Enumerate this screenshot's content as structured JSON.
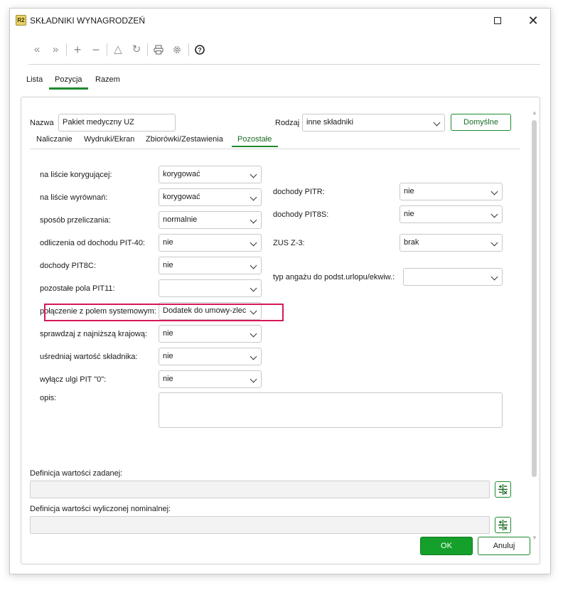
{
  "window": {
    "title": "SKŁADNIKI WYNAGRODZEŃ",
    "app_icon_text": "R2"
  },
  "toolbar": {
    "icons": [
      "first-icon",
      "last-icon",
      "add-icon",
      "remove-icon",
      "warning-icon",
      "refresh-icon",
      "print-icon",
      "settings-icon",
      "help-icon"
    ]
  },
  "main_tabs": [
    {
      "label": "Lista",
      "active": false
    },
    {
      "label": "Pozycja",
      "active": true
    },
    {
      "label": "Razem",
      "active": false
    }
  ],
  "header": {
    "name_label": "Nazwa",
    "name_value": "Pakiet medyczny UZ",
    "type_label": "Rodzaj",
    "type_value": "inne składniki",
    "defaults_button": "Domyślne"
  },
  "sub_tabs": [
    {
      "label": "Naliczanie",
      "active": false
    },
    {
      "label": "Wydruki/Ekran",
      "active": false
    },
    {
      "label": "Zbiorówki/Zestawienia",
      "active": false
    },
    {
      "label": "Pozostałe",
      "active": true
    }
  ],
  "left_fields": [
    {
      "label": "na liście korygującej:",
      "value": "korygować"
    },
    {
      "label": "na liście wyrównań:",
      "value": "korygować"
    },
    {
      "label": "sposób przeliczania:",
      "value": "normalnie"
    },
    {
      "label": "odliczenia od dochodu PIT-40:",
      "value": "nie"
    },
    {
      "label": "dochody PIT8C:",
      "value": "nie"
    },
    {
      "label": "pozostałe pola PIT11:",
      "value": ""
    },
    {
      "label": "połączenie z polem systemowym:",
      "value": "Dodatek do umowy-zlec"
    },
    {
      "label": "sprawdzaj z najniższą krajową:",
      "value": "nie"
    },
    {
      "label": "uśredniaj wartość składnika:",
      "value": "nie"
    },
    {
      "label": "wyłącz ulgi PIT \"0\":",
      "value": "nie"
    }
  ],
  "right_fields": [
    {
      "label": "dochody PITR:",
      "value": "nie"
    },
    {
      "label": "dochody PIT8S:",
      "value": "nie"
    },
    {
      "label": "ZUS Z-3:",
      "value": "brak"
    },
    {
      "label": "typ angażu do podst.urlopu/ekwiw.:",
      "value": ""
    }
  ],
  "description": {
    "label": "opis:",
    "value": ""
  },
  "definitions": [
    {
      "label": "Definicja wartości zadanej:"
    },
    {
      "label": "Definicja wartości wyliczonej nominalnej:"
    }
  ],
  "footer": {
    "ok_label": "OK",
    "cancel_label": "Anuluj"
  },
  "colors": {
    "accent": "#1e8a2e",
    "highlight": "#d6185a",
    "ok_bg": "#14a02a"
  }
}
